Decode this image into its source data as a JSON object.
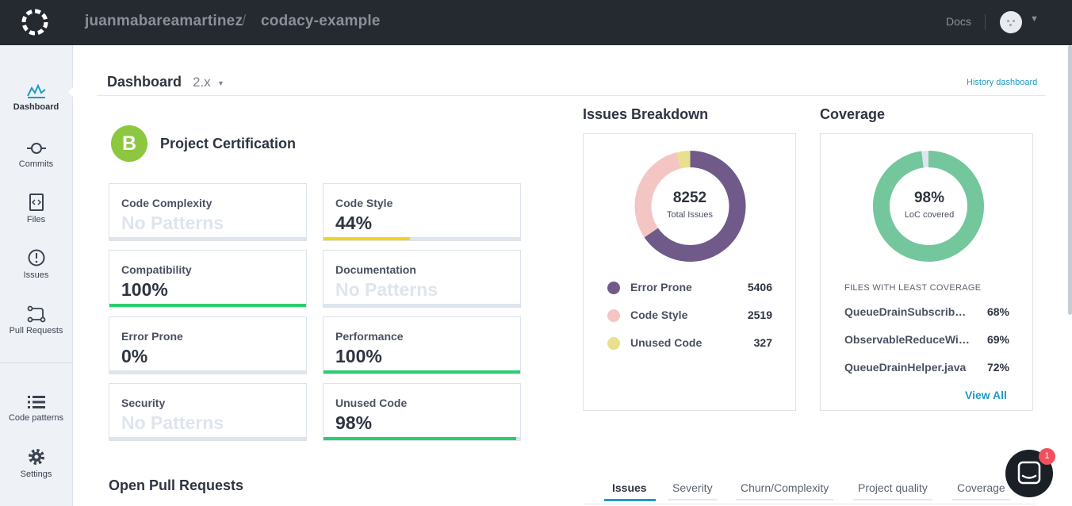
{
  "topbar": {
    "org": "juanmabareamartinez",
    "separator": "/",
    "repo": "codacy-example",
    "docs": "Docs",
    "user_menu_icon": "chevron-down-icon"
  },
  "sidebar": {
    "items": [
      {
        "label": "Dashboard",
        "icon": "dashboard-icon"
      },
      {
        "label": "Commits",
        "icon": "commit-icon"
      },
      {
        "label": "Files",
        "icon": "file-code-icon"
      },
      {
        "label": "Issues",
        "icon": "alert-circle-icon"
      },
      {
        "label": "Pull Requests",
        "icon": "pull-request-icon"
      },
      {
        "label": "Code patterns",
        "icon": "list-icon"
      },
      {
        "label": "Settings",
        "icon": "gear-icon"
      }
    ]
  },
  "header": {
    "title": "Dashboard",
    "version": "2.x",
    "history_link": "History dashboard"
  },
  "certification": {
    "grade": "B",
    "title": "Project Certification",
    "grade_color": "#8dc63f",
    "cards": [
      {
        "label": "Code Complexity",
        "value": "No Patterns",
        "progress": null
      },
      {
        "label": "Code Style",
        "value": "44%",
        "progress": 0.44,
        "color": "#f2d321"
      },
      {
        "label": "Compatibility",
        "value": "100%",
        "progress": 1.0,
        "color": "#2ecc71"
      },
      {
        "label": "Documentation",
        "value": "No Patterns",
        "progress": null
      },
      {
        "label": "Error Prone",
        "value": "0%",
        "progress": 0.0,
        "color": "#2ecc71"
      },
      {
        "label": "Performance",
        "value": "100%",
        "progress": 1.0,
        "color": "#2ecc71"
      },
      {
        "label": "Security",
        "value": "No Patterns",
        "progress": null
      },
      {
        "label": "Unused Code",
        "value": "98%",
        "progress": 0.98,
        "color": "#2ecc71"
      }
    ]
  },
  "issues_breakdown": {
    "title": "Issues Breakdown",
    "total": "8252",
    "total_label": "Total Issues",
    "items": [
      {
        "label": "Error Prone",
        "value": "5406",
        "count": 5406,
        "color": "#6f5a8a"
      },
      {
        "label": "Code Style",
        "value": "2519",
        "count": 2519,
        "color": "#f3c6c4"
      },
      {
        "label": "Unused Code",
        "value": "327",
        "count": 327,
        "color": "#e8e08c"
      }
    ]
  },
  "coverage": {
    "title": "Coverage",
    "percent": "98%",
    "percent_label": "LoC covered",
    "fraction": 0.98,
    "color": "#74c69d",
    "files_heading": "FILES WITH LEAST COVERAGE",
    "files": [
      {
        "name": "QueueDrainSubscriber.java",
        "pct": "68%"
      },
      {
        "name": "ObservableReduceWithSingle.java",
        "pct": "69%"
      },
      {
        "name": "QueueDrainHelper.java",
        "pct": "72%"
      }
    ],
    "view_all": "View All"
  },
  "open_prs": {
    "title": "Open Pull Requests"
  },
  "tabs": [
    "Issues",
    "Severity",
    "Churn/Complexity",
    "Project quality",
    "Coverage"
  ],
  "chat": {
    "badge": "1"
  },
  "accent": "#1e9bc7"
}
